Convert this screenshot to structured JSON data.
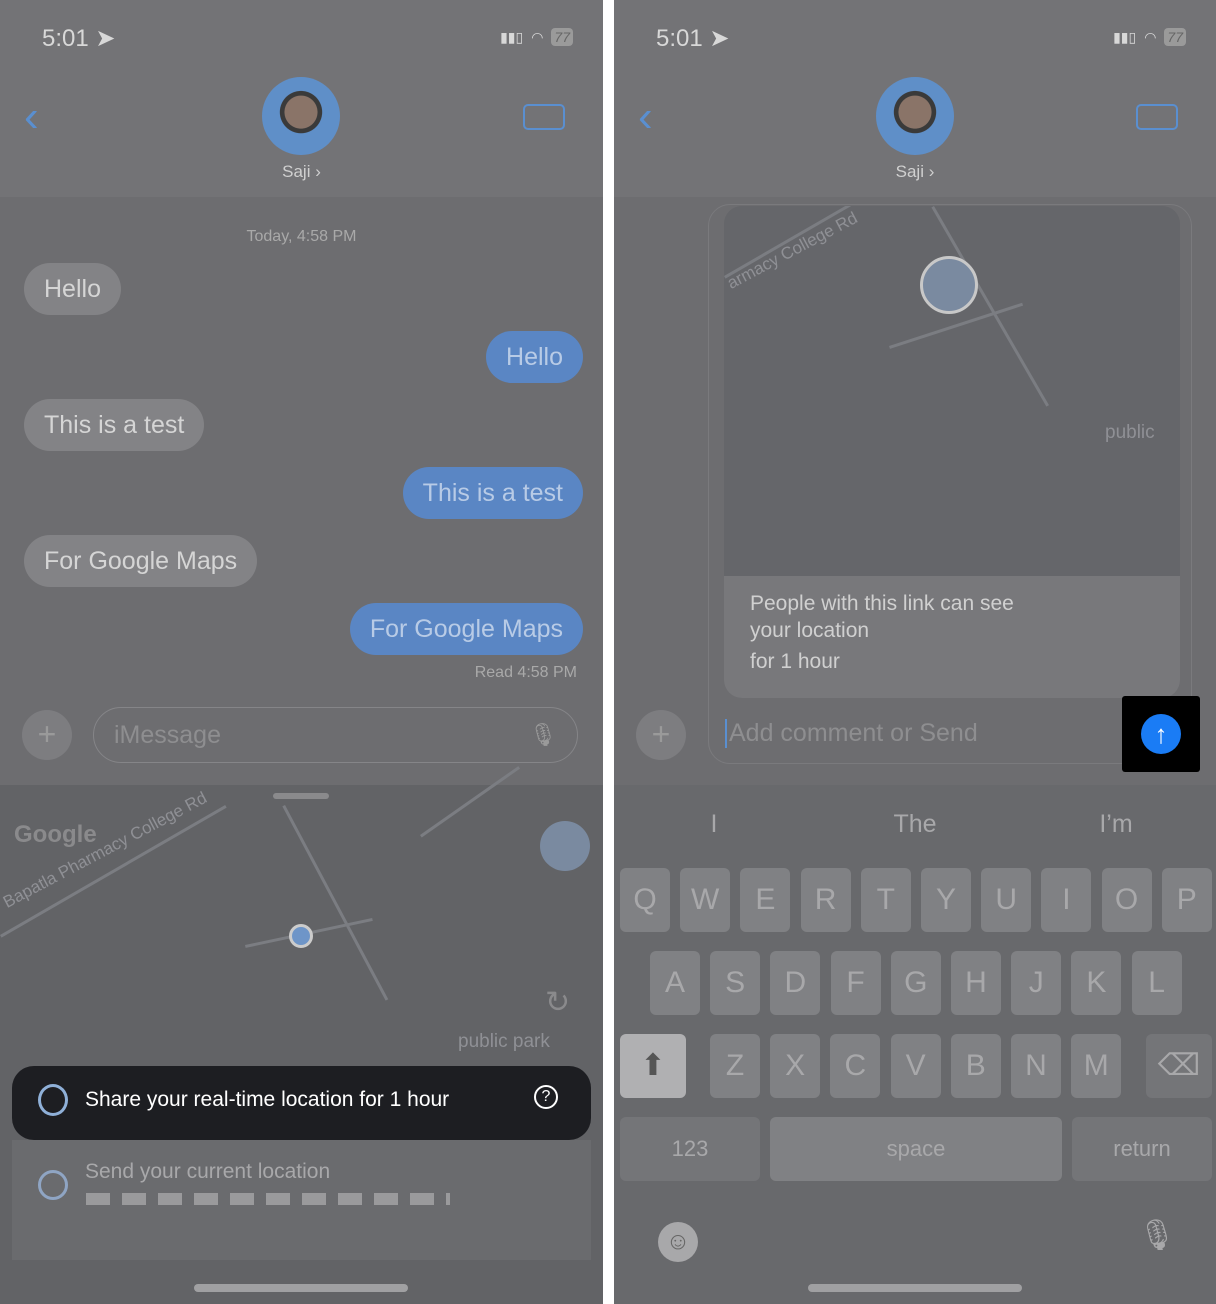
{
  "status": {
    "time": "5:01",
    "battery": "77"
  },
  "contact": {
    "name": "Saji ›"
  },
  "left": {
    "timestamp": "Today, 4:58 PM",
    "messages": [
      {
        "dir": "in",
        "text": "Hello"
      },
      {
        "dir": "out",
        "text": "Hello"
      },
      {
        "dir": "in",
        "text": "This is a test"
      },
      {
        "dir": "out",
        "text": "This is a test"
      },
      {
        "dir": "in",
        "text": "For Google Maps"
      },
      {
        "dir": "out",
        "text": "For Google Maps"
      }
    ],
    "read": "Read 4:58 PM",
    "input_placeholder": "iMessage",
    "map_labels": {
      "road": "Bapatla Pharmacy College Rd",
      "park": "public park",
      "logo": "Google"
    },
    "share_realtime": "Share your real-time location for 1 hour",
    "send_current": "Send your current location"
  },
  "right": {
    "map_labels": {
      "road": "armacy College Rd",
      "park": "public"
    },
    "card_text": "People with this link can see your location",
    "card_duration": "for 1 hour",
    "input_placeholder": "Add comment or Send",
    "suggestions": [
      "I",
      "The",
      "I’m"
    ],
    "rows": [
      [
        "Q",
        "W",
        "E",
        "R",
        "T",
        "Y",
        "U",
        "I",
        "O",
        "P"
      ],
      [
        "A",
        "S",
        "D",
        "F",
        "G",
        "H",
        "J",
        "K",
        "L"
      ],
      [
        "Z",
        "X",
        "C",
        "V",
        "B",
        "N",
        "M"
      ]
    ],
    "key_123": "123",
    "key_space": "space",
    "key_return": "return"
  },
  "colors": {
    "accent": "#5a8fd0",
    "send": "#1a7cf5"
  }
}
